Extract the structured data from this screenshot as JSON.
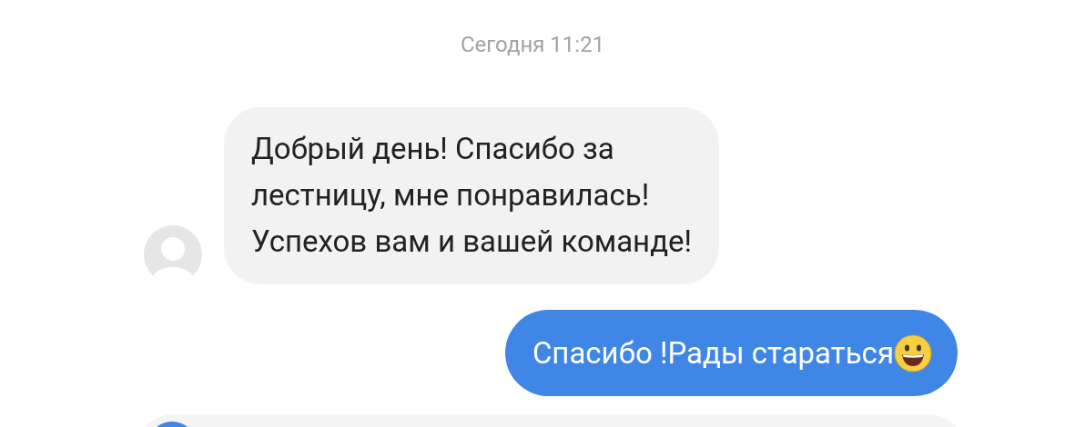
{
  "timestamp": "Сегодня 11:21",
  "messages": [
    {
      "kind": "incoming",
      "text": "Добрый день! Спасибо за\nлестницу, мне понравилась!\nУспехов вам и вашей команде!"
    },
    {
      "kind": "outgoing",
      "text": "Спасибо !Рады стараться"
    }
  ]
}
